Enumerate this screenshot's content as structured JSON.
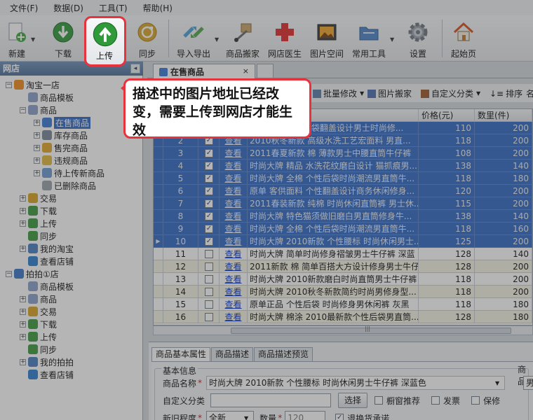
{
  "menubar": {
    "items": [
      "文件(F)",
      "数据(D)",
      "工具(T)",
      "帮助(H)"
    ]
  },
  "toolbar": {
    "buttons": [
      {
        "label": "新建",
        "icon": "new-icon"
      },
      {
        "label": "下载",
        "icon": "download-icon"
      },
      {
        "label": "上传",
        "icon": "upload-icon"
      },
      {
        "label": "同步",
        "icon": "sync-icon"
      },
      {
        "label": "导入导出",
        "icon": "import-export-icon"
      },
      {
        "label": "商品搬家",
        "icon": "move-goods-icon"
      },
      {
        "label": "网店医生",
        "icon": "doctor-icon"
      },
      {
        "label": "图片空间",
        "icon": "image-space-icon"
      },
      {
        "label": "常用工具",
        "icon": "tools-icon"
      },
      {
        "label": "设置",
        "icon": "gear-icon"
      },
      {
        "label": "起始页",
        "icon": "home-icon"
      }
    ]
  },
  "left_panel": {
    "title": "网店",
    "pin_glyph": "◂",
    "tree": [
      {
        "label": "淘宝一店",
        "level": 0,
        "exp": "−",
        "icon": "taobao-shop-icon",
        "color": "#f08c1e"
      },
      {
        "label": "商品模板",
        "level": 1,
        "exp": "",
        "icon": "template-icon",
        "color": "#8aa0c8"
      },
      {
        "label": "商品",
        "level": 1,
        "exp": "−",
        "icon": "goods-folder-icon",
        "color": "#8aa0c8"
      },
      {
        "label": "在售商品",
        "level": 2,
        "exp": "+",
        "icon": "on-sale-icon",
        "color": "#3b7bd6",
        "selected": true
      },
      {
        "label": "库存商品",
        "level": 2,
        "exp": "+",
        "icon": "stock-icon",
        "color": "#7a8898"
      },
      {
        "label": "售完商品",
        "level": 2,
        "exp": "+",
        "icon": "sold-out-icon",
        "color": "#e3a62b"
      },
      {
        "label": "违规商品",
        "level": 2,
        "exp": "+",
        "icon": "violation-icon",
        "color": "#e2b83b"
      },
      {
        "label": "待上传新商品",
        "level": 2,
        "exp": "+",
        "icon": "pending-upload-icon",
        "color": "#6c9bd2"
      },
      {
        "label": "已删除商品",
        "level": 2,
        "exp": "",
        "icon": "trash-icon",
        "color": "#9aa2ad"
      },
      {
        "label": "交易",
        "level": 1,
        "exp": "+",
        "icon": "trade-icon",
        "color": "#d9a521"
      },
      {
        "label": "下载",
        "level": 1,
        "exp": "+",
        "icon": "download-icon",
        "color": "#3c9a3c"
      },
      {
        "label": "上传",
        "level": 1,
        "exp": "+",
        "icon": "upload-icon",
        "color": "#3c9a3c"
      },
      {
        "label": "同步",
        "level": 1,
        "exp": "",
        "icon": "sync-icon",
        "color": "#3c9a3c"
      },
      {
        "label": "我的淘宝",
        "level": 1,
        "exp": "+",
        "icon": "network-icon",
        "color": "#4a7fc0"
      },
      {
        "label": "查看店铺",
        "level": 1,
        "exp": "",
        "icon": "globe-icon",
        "color": "#2f7fd0"
      },
      {
        "label": "拍拍①店",
        "level": 0,
        "exp": "−",
        "icon": "paipai-shop-icon",
        "color": "#3a78c8"
      },
      {
        "label": "商品模板",
        "level": 1,
        "exp": "",
        "icon": "template-icon",
        "color": "#8aa0c8"
      },
      {
        "label": "商品",
        "level": 1,
        "exp": "+",
        "icon": "goods-folder-icon",
        "color": "#8aa0c8"
      },
      {
        "label": "交易",
        "level": 1,
        "exp": "+",
        "icon": "trade-icon",
        "color": "#d9a521"
      },
      {
        "label": "下载",
        "level": 1,
        "exp": "+",
        "icon": "download-icon",
        "color": "#3c9a3c"
      },
      {
        "label": "上传",
        "level": 1,
        "exp": "+",
        "icon": "upload-icon",
        "color": "#3c9a3c"
      },
      {
        "label": "同步",
        "level": 1,
        "exp": "",
        "icon": "sync-icon",
        "color": "#3c9a3c"
      },
      {
        "label": "我的拍拍",
        "level": 1,
        "exp": "+",
        "icon": "network-icon",
        "color": "#4a7fc0"
      },
      {
        "label": "查看店铺",
        "level": 1,
        "exp": "",
        "icon": "globe-icon",
        "color": "#2f7fd0"
      }
    ]
  },
  "doc_tab": {
    "label": "在售商品",
    "close": "×"
  },
  "inner_toolbar": {
    "batch_edit": "批量修改",
    "image_move": "图片搬家",
    "custom_category": "自定义分类",
    "sort": "排序",
    "truncated": "名"
  },
  "grid": {
    "headers": {
      "name": "商品名",
      "price": "价格(元)",
      "qty": "数里(件)"
    },
    "view_label": "查看",
    "current_row": 10,
    "rows": [
      {
        "no": "1",
        "checked": true,
        "name": "时尚大牌 个性后袋翻盖设计男士时尚修...",
        "price": "110",
        "qty": "200",
        "sel": true
      },
      {
        "no": "2",
        "checked": true,
        "name": "2010秋冬新款 高级水洗工艺宏面料 男直...",
        "price": "118",
        "qty": "200",
        "sel": true
      },
      {
        "no": "3",
        "checked": true,
        "name": "2011春夏新款 棉 薄款男士中腰直筒牛仔裤",
        "price": "108",
        "qty": "200",
        "sel": true
      },
      {
        "no": "4",
        "checked": true,
        "name": "时尚大牌 精品 水洗花纹磨白设计 猫抓痕男...",
        "price": "138",
        "qty": "140",
        "sel": true
      },
      {
        "no": "5",
        "checked": true,
        "name": "时尚大牌 全棉 个性后袋时尚潮流男直筒牛...",
        "price": "118",
        "qty": "180",
        "sel": true
      },
      {
        "no": "6",
        "checked": true,
        "name": "原单 客供面料 个性翻盖设计商务休闲修身...",
        "price": "120",
        "qty": "200",
        "sel": true
      },
      {
        "no": "7",
        "checked": true,
        "name": "2011春装新款 纯棉 时尚休闲直筒裤 男士休...",
        "price": "115",
        "qty": "200",
        "sel": true
      },
      {
        "no": "8",
        "checked": true,
        "name": "时尚大牌 特色猫须做旧磨白男直筒修身牛...",
        "price": "138",
        "qty": "140",
        "sel": true
      },
      {
        "no": "9",
        "checked": true,
        "name": "时尚大牌 全棉 个性后袋时尚潮流男直筒牛...",
        "price": "118",
        "qty": "160",
        "sel": true
      },
      {
        "no": "10",
        "checked": true,
        "name": "时尚大牌 2010新款 个性腰标 时尚休闲男士...",
        "price": "125",
        "qty": "200",
        "sel": true
      },
      {
        "no": "11",
        "checked": false,
        "name": "时尚大牌 简单时尚修身褶皱男士牛仔裤 深蓝",
        "price": "128",
        "qty": "140",
        "sel": false
      },
      {
        "no": "12",
        "checked": false,
        "name": "2011新款 棉 简单百搭大方设计修身男士牛仔裤",
        "price": "128",
        "qty": "200",
        "sel": false
      },
      {
        "no": "13",
        "checked": false,
        "name": "时尚大牌 2010新款磨白时尚直筒男士牛仔裤",
        "price": "118",
        "qty": "200",
        "sel": false
      },
      {
        "no": "14",
        "checked": false,
        "name": "时尚大牌 2010秋冬新款简约时尚男修身型...",
        "price": "118",
        "qty": "200",
        "sel": false
      },
      {
        "no": "15",
        "checked": false,
        "name": "原单正品 个性后袋 时尚修身男休闲裤 灰黑",
        "price": "118",
        "qty": "180",
        "sel": false
      },
      {
        "no": "16",
        "checked": false,
        "name": "时尚大牌 棉涂 2010最新款个性后袋男直筒...",
        "price": "128",
        "qty": "180",
        "sel": false
      }
    ]
  },
  "bottom_panel": {
    "tabs": [
      "商品基本属性",
      "商品描述",
      "商品描述预览"
    ],
    "section_title": "基本信息",
    "name_label": "商品名称",
    "name_value": "时尚大牌 2010新款 个性腰标 时尚休闲男士牛仔裤 深蓝色",
    "custom_category_label": "自定义分类",
    "select_button": "选择",
    "showcase": "橱窗推荐",
    "invoice": "发票",
    "warranty": "保修",
    "newness_label": "新旧程度",
    "newness_value": "全新",
    "qty_label": "数量",
    "qty_value": "120",
    "return_promise": "退换货承诺",
    "right_fragment": "商品",
    "right_fragment2": "男"
  },
  "callout": {
    "text": "描述中的图片地址已经改变，需要上传到网店才能生效"
  },
  "colors": {
    "highlight_red": "#e8323c",
    "selection_blue": "#316ac5"
  }
}
